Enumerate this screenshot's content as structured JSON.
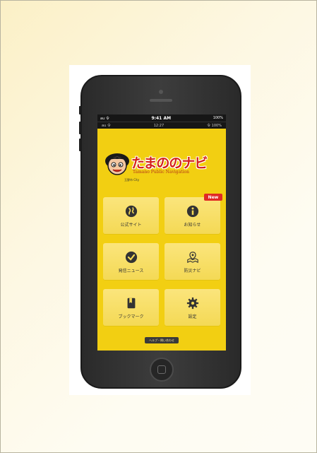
{
  "status_bar": {
    "carrier": "au 令",
    "time": "9:41 AM",
    "battery": "100%"
  },
  "nav_bar": {
    "left": "au 令",
    "center": "12:27",
    "right": "令 100%"
  },
  "logo": {
    "title": "たまののナビ",
    "subtitle": "Tamano Public Navigation",
    "small": "玉野市 City"
  },
  "tiles": [
    {
      "label": "公式サイト",
      "icon": "globe-icon"
    },
    {
      "label": "お知らせ",
      "icon": "info-icon",
      "badge": "New"
    },
    {
      "label": "発信ニュース",
      "icon": "checkmark-icon"
    },
    {
      "label": "防災ナビ",
      "icon": "map-pin-icon"
    },
    {
      "label": "ブックマーク",
      "icon": "bookmark-icon"
    },
    {
      "label": "設定",
      "icon": "gear-icon"
    }
  ],
  "footer": {
    "button_label": "ヘルプ・問い合わせ"
  },
  "colors": {
    "screen_bg": "#f2cf12",
    "tile_bg": "#f8e06a",
    "accent_red": "#d4221a",
    "phone_body": "#2f2f2f"
  }
}
